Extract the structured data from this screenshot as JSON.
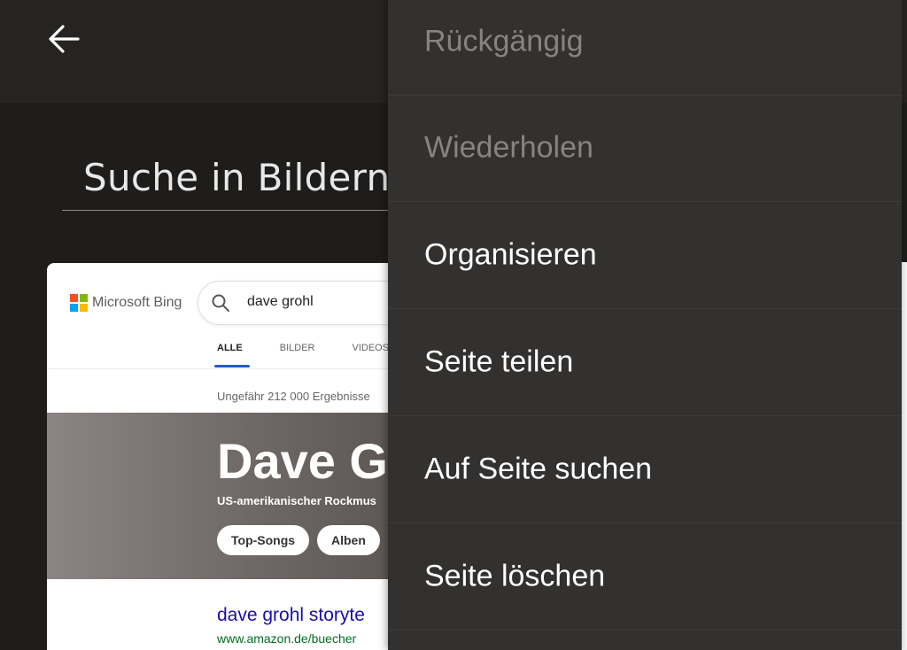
{
  "header": {
    "back_icon": "arrow-left-icon"
  },
  "search": {
    "title": "Suche in Bildern"
  },
  "thumbnail": {
    "logo_text": "Microsoft Bing",
    "search_query": "dave grohl",
    "tabs": [
      "ALLE",
      "BILDER",
      "VIDEOS"
    ],
    "result_count": "Ungefähr 212 000 Ergebnisse",
    "hero_name": "Dave G",
    "hero_subtitle": "US-amerikanischer Rockmus",
    "chips": [
      "Top-Songs",
      "Alben"
    ],
    "result_title": "dave grohl storyte",
    "result_url": "www.amazon.de/buecher"
  },
  "menu": {
    "items": [
      {
        "label": "Rückgängig",
        "enabled": false
      },
      {
        "label": "Wiederholen",
        "enabled": false
      },
      {
        "label": "Organisieren",
        "enabled": true
      },
      {
        "label": "Seite teilen",
        "enabled": true
      },
      {
        "label": "Auf Seite suchen",
        "enabled": true
      },
      {
        "label": "Seite löschen",
        "enabled": true
      }
    ]
  },
  "colors": {
    "background": "#1f1e1d",
    "topbar": "#252423",
    "menu_background": "#323130",
    "menu_text": "#ffffff",
    "menu_text_disabled": "#858483",
    "bing_link": "#1a0dab",
    "bing_url": "#006d21",
    "bing_tab_active": "#1f5dc7"
  }
}
